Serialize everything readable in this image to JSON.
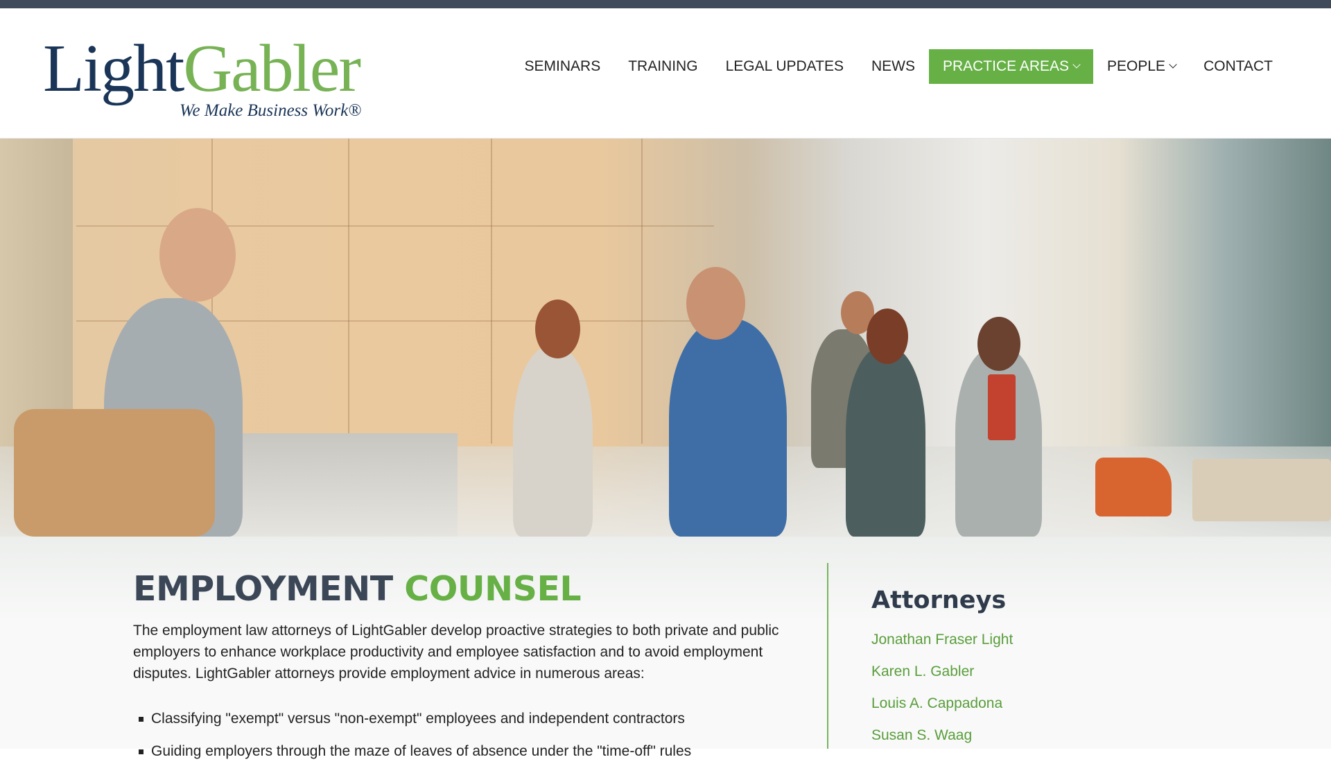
{
  "brand": {
    "logo_word_1": "Light",
    "logo_word_2": "Gabler",
    "tagline": "We Make Business Work®",
    "colors": {
      "navy": "#1a3558",
      "green": "#66b046",
      "topbar": "#3f4b5b"
    }
  },
  "nav": {
    "items": [
      {
        "label": "SEMINARS",
        "dropdown": false,
        "active": false
      },
      {
        "label": "TRAINING",
        "dropdown": false,
        "active": false
      },
      {
        "label": "LEGAL UPDATES",
        "dropdown": false,
        "active": false
      },
      {
        "label": "NEWS",
        "dropdown": false,
        "active": false
      },
      {
        "label": "PRACTICE AREAS",
        "dropdown": true,
        "active": true
      },
      {
        "label": "PEOPLE",
        "dropdown": true,
        "active": false
      },
      {
        "label": "CONTACT",
        "dropdown": false,
        "active": false
      }
    ]
  },
  "main": {
    "title_part_1": "EMPLOYMENT",
    "title_part_2": "COUNSEL",
    "intro": "The employment law attorneys of LightGabler develop proactive strategies to both private and public employers to enhance workplace productivity and employee satisfaction and to avoid employment disputes. LightGabler attorneys provide employment advice in numerous areas:",
    "list": [
      "Classifying \"exempt\" versus \"non-exempt\" employees and independent contractors",
      "Guiding employers through the maze of leaves of absence under the \"time-off\" rules"
    ]
  },
  "sidebar": {
    "title": "Attorneys",
    "attorneys": [
      "Jonathan Fraser Light",
      "Karen L. Gabler",
      "Louis A. Cappadona",
      "Susan S. Waag"
    ]
  }
}
